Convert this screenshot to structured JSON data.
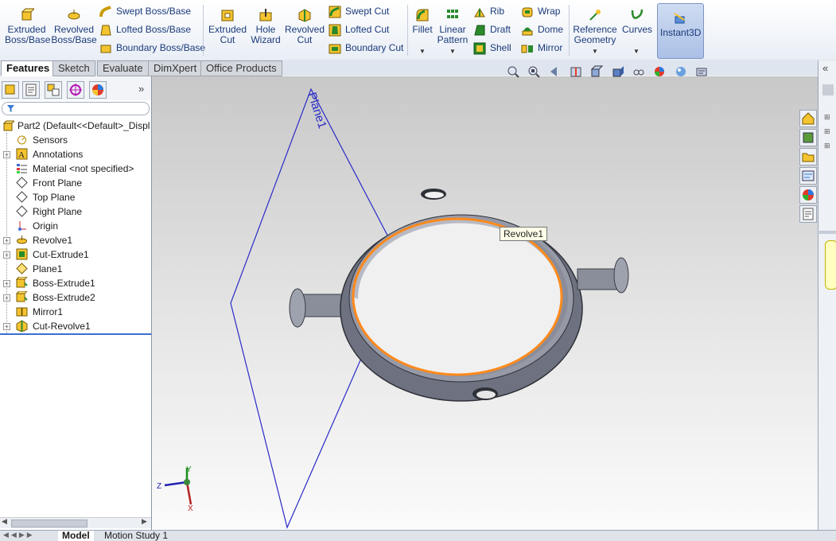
{
  "ribbon": {
    "extruded_boss": "Extruded\nBoss/Base",
    "revolved_boss": "Revolved\nBoss/Base",
    "swept_boss": "Swept Boss/Base",
    "lofted_boss": "Lofted Boss/Base",
    "boundary_boss": "Boundary Boss/Base",
    "extruded_cut": "Extruded\nCut",
    "hole_wizard": "Hole\nWizard",
    "revolved_cut": "Revolved\nCut",
    "swept_cut": "Swept Cut",
    "lofted_cut": "Lofted Cut",
    "boundary_cut": "Boundary Cut",
    "fillet": "Fillet",
    "linear_pattern": "Linear\nPattern",
    "rib": "Rib",
    "draft": "Draft",
    "shell": "Shell",
    "wrap": "Wrap",
    "dome": "Dome",
    "mirror": "Mirror",
    "reference_geometry": "Reference\nGeometry",
    "curves": "Curves",
    "instant3d": "Instant3D"
  },
  "tabs": [
    "Features",
    "Sketch",
    "Evaluate",
    "DimXpert",
    "Office Products"
  ],
  "tree": {
    "root": "Part2  (Default<<Default>_Displ",
    "items": [
      {
        "label": "Sensors",
        "expand": false
      },
      {
        "label": "Annotations",
        "expand": true
      },
      {
        "label": "Material <not specified>",
        "expand": false
      },
      {
        "label": "Front Plane",
        "expand": false
      },
      {
        "label": "Top Plane",
        "expand": false
      },
      {
        "label": "Right Plane",
        "expand": false
      },
      {
        "label": "Origin",
        "expand": false
      },
      {
        "label": "Revolve1",
        "expand": true
      },
      {
        "label": "Cut-Extrude1",
        "expand": true
      },
      {
        "label": "Plane1",
        "expand": false
      },
      {
        "label": "Boss-Extrude1",
        "expand": true
      },
      {
        "label": "Boss-Extrude2",
        "expand": true
      },
      {
        "label": "Mirror1",
        "expand": false
      },
      {
        "label": "Cut-Revolve1",
        "expand": true
      }
    ]
  },
  "viewport": {
    "plane_label": "Plane1",
    "tooltip": "Revolve1",
    "triad": {
      "x": "X",
      "y": "Y",
      "z": "Z"
    }
  },
  "bottom_tabs": [
    "Model",
    "Motion Study 1"
  ],
  "colors": {
    "highlight_edge": "#ff8a1c",
    "plane_edge": "#2a2ac8",
    "part_body": "#7a7e8c"
  }
}
